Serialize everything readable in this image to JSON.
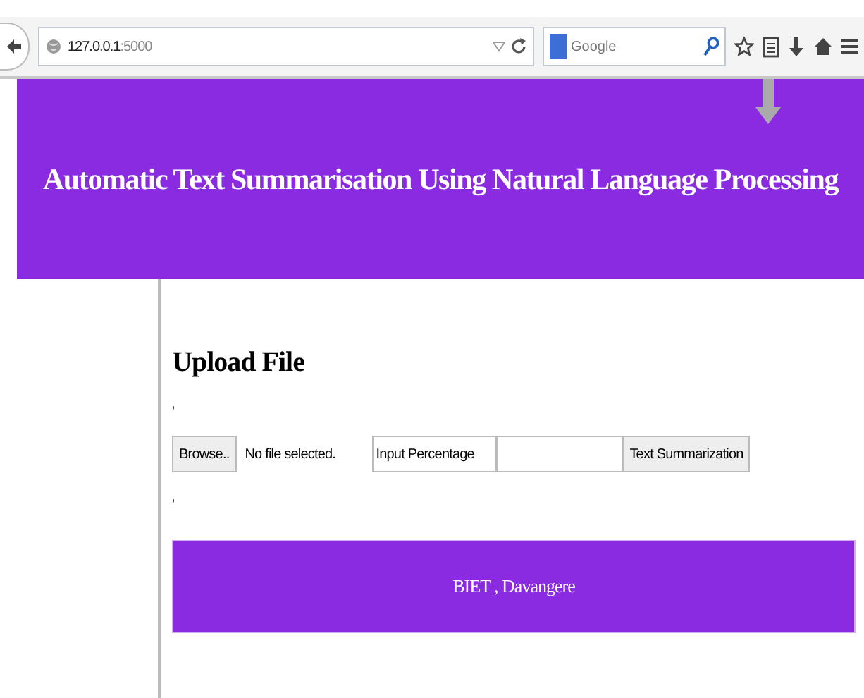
{
  "browser": {
    "url_host": "127.0.0.1",
    "url_port": ":5000",
    "search_placeholder": "Google"
  },
  "header": {
    "title": "Automatic Text Summarisation Using Natural Language Processing"
  },
  "main": {
    "heading": "Upload File",
    "mark_1": "'",
    "browse_button": "Browse..",
    "file_status": "No file selected.",
    "percentage_label": "Input Percentage",
    "submit_button": "Text Summarization",
    "mark_2": "'"
  },
  "footer": {
    "text": "BIET , Davangere"
  }
}
